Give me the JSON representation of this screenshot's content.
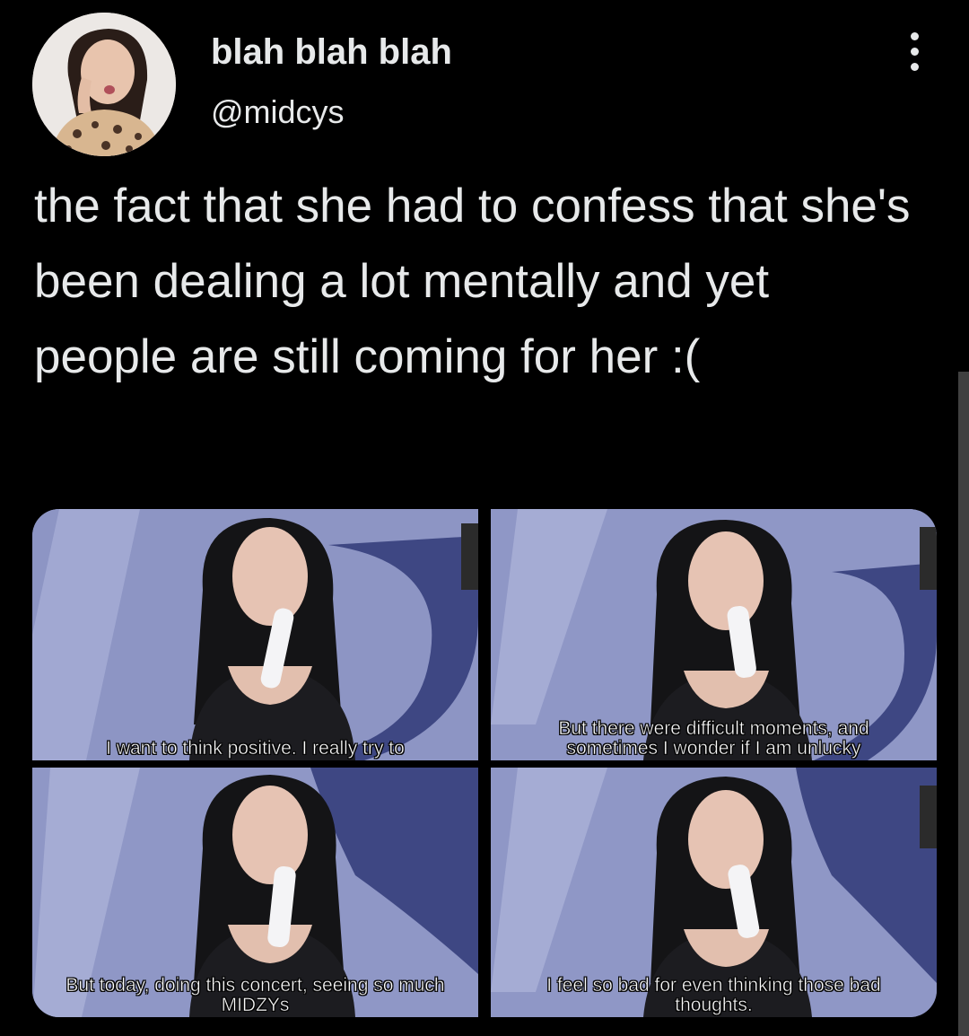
{
  "author": {
    "display_name": "blah blah blah",
    "handle": "@midcys"
  },
  "tweet": {
    "text": "the fact that she had to confess that she's been dealing a lot mentally and yet people are still coming for her :("
  },
  "media": [
    {
      "caption": "I want to think positive. I really try to"
    },
    {
      "caption": "But there were difficult moments, and sometimes I wonder if I am unlucky"
    },
    {
      "caption": "But today, doing this concert, seeing so much MIDZYs"
    },
    {
      "caption": "I feel so bad for even thinking those bad thoughts."
    }
  ],
  "icons": {
    "more": "more-options-icon"
  },
  "colors": {
    "background": "#000000",
    "text": "#e7e9ea",
    "stage_backdrop": "#8f97c6"
  }
}
